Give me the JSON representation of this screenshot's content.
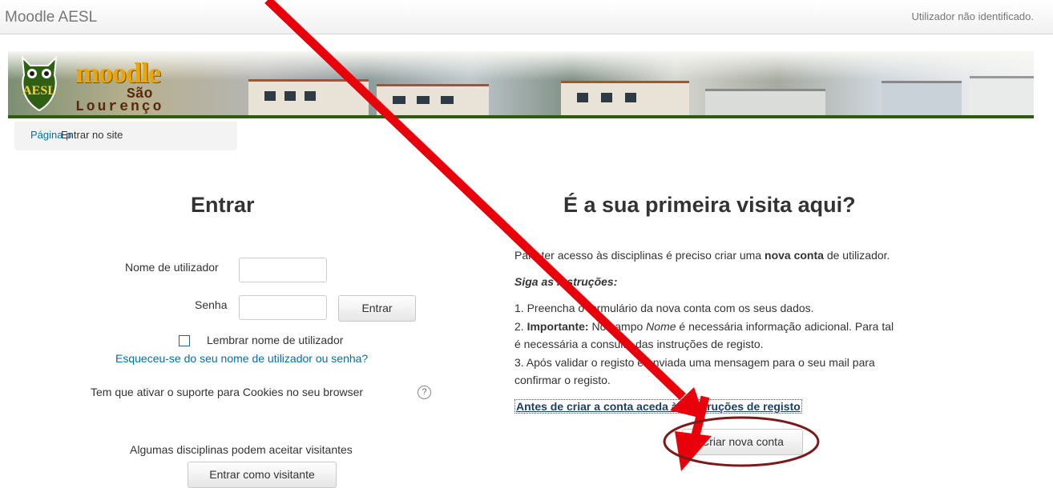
{
  "header": {
    "brand": "Moodle AESL",
    "login_info": "Utilizador não identificado."
  },
  "banner": {
    "logo_line1": "moodle",
    "logo_line2": "São",
    "logo_line3": "Lourenço",
    "owl_text": "AESL"
  },
  "breadcrumb": {
    "home": "Página p",
    "current": "Entrar no site"
  },
  "login": {
    "heading": "Entrar",
    "username_label": "Nome de utilizador",
    "username_value": "",
    "password_label": "Senha",
    "password_value": "",
    "submit": "Entrar",
    "remember_label": "Lembrar nome de utilizador",
    "forgot_link": "Esqueceu-se do seu nome de utilizador ou senha?",
    "cookies_note": "Tem que ativar o suporte para Cookies no seu browser",
    "help_icon": "?",
    "guest_note": "Algumas disciplinas podem aceitar visitantes",
    "guest_button": "Entrar como visitante"
  },
  "signup": {
    "heading": "É a sua primeira visita aqui?",
    "intro_before": "Para ter acesso às disciplinas é preciso criar uma ",
    "intro_bold": "nova conta",
    "intro_after": " de utilizador.",
    "instructions_title": "Siga as instruções:",
    "step1": "1. Preencha o formulário da nova conta com os seus dados.",
    "step2_prefix": "2. ",
    "step2_bold": "Importante:",
    "step2_a": " No campo ",
    "step2_em": "Nome",
    "step2_b": " é necessária informação adicional. Para tal",
    "step2_line2": "é necessária a consulta das instruções de registo.",
    "step3_line1": "3. Após validar o registo é enviada uma mensagem para o seu mail para",
    "step3_line2": "confirmar o registo.",
    "instructions_link": "Antes de criar a conta aceda às instruções de registo",
    "create_button": "Criar nova conta"
  },
  "annotation": {
    "arrow_color": "#e8000b",
    "ellipse_color": "#7a1a1a"
  }
}
